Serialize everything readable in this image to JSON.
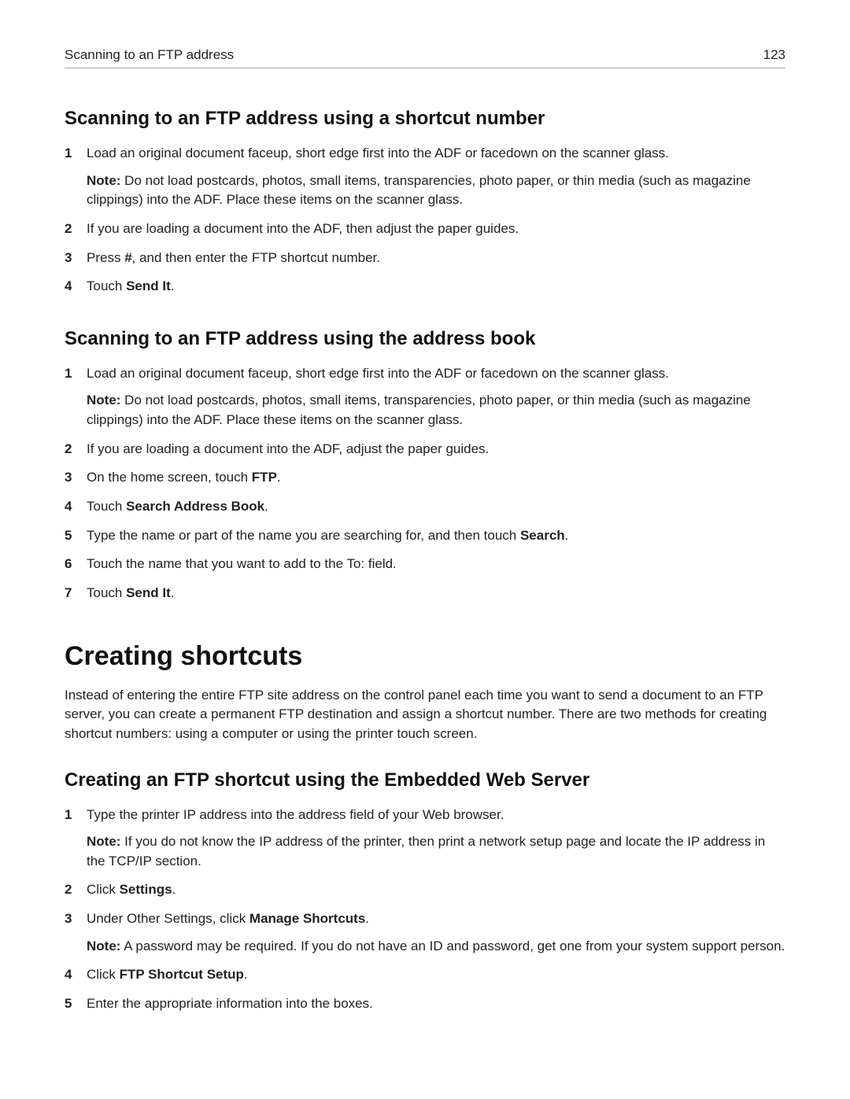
{
  "header": {
    "title": "Scanning to an FTP address",
    "page": "123"
  },
  "section1": {
    "title": "Scanning to an FTP address using a shortcut number",
    "step1": "Load an original document faceup, short edge first into the ADF or facedown on the scanner glass.",
    "step1_note_label": "Note:",
    "step1_note": " Do not load postcards, photos, small items, transparencies, photo paper, or thin media (such as magazine clippings) into the ADF. Place these items on the scanner glass.",
    "step2": "If you are loading a document into the ADF, then adjust the paper guides.",
    "step3_a": "Press ",
    "step3_b": "#",
    "step3_c": ", and then enter the FTP shortcut number.",
    "step4_a": "Touch ",
    "step4_b": "Send It",
    "step4_c": "."
  },
  "section2": {
    "title": "Scanning to an FTP address using the address book",
    "step1": "Load an original document faceup, short edge first into the ADF or facedown on the scanner glass.",
    "step1_note_label": "Note:",
    "step1_note": " Do not load postcards, photos, small items, transparencies, photo paper, or thin media (such as magazine clippings) into the ADF. Place these items on the scanner glass.",
    "step2": "If you are loading a document into the ADF, adjust the paper guides.",
    "step3_a": "On the home screen, touch ",
    "step3_b": "FTP",
    "step3_c": ".",
    "step4_a": "Touch ",
    "step4_b": "Search Address Book",
    "step4_c": ".",
    "step5_a": "Type the name or part of the name you are searching for, and then touch ",
    "step5_b": "Search",
    "step5_c": ".",
    "step6": "Touch the name that you want to add to the To: field.",
    "step7_a": "Touch ",
    "step7_b": "Send It",
    "step7_c": "."
  },
  "section3": {
    "title": "Creating shortcuts",
    "intro": "Instead of entering the entire FTP site address on the control panel each time you want to send a document to an FTP server, you can create a permanent FTP destination and assign a shortcut number. There are two methods for creating shortcut numbers: using a computer or using the printer touch screen."
  },
  "section4": {
    "title": "Creating an FTP shortcut using the Embedded Web Server",
    "step1": "Type the printer IP address into the address field of your Web browser.",
    "step1_note_label": "Note:",
    "step1_note": " If you do not know the IP address of the printer, then print a network setup page and locate the IP address in the TCP/IP section.",
    "step2_a": "Click ",
    "step2_b": "Settings",
    "step2_c": ".",
    "step3_a": "Under Other Settings, click ",
    "step3_b": "Manage Shortcuts",
    "step3_c": ".",
    "step3_note_label": "Note:",
    "step3_note": " A password may be required. If you do not have an ID and password, get one from your system support person.",
    "step4_a": "Click ",
    "step4_b": "FTP Shortcut Setup",
    "step4_c": ".",
    "step5": "Enter the appropriate information into the boxes."
  }
}
